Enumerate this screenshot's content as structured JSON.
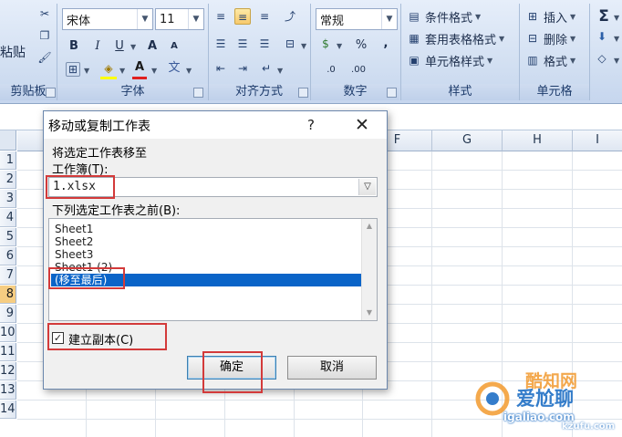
{
  "ribbon": {
    "clipboard": {
      "paste_label": "粘贴",
      "group_label": "剪贴板"
    },
    "font": {
      "font_name": "宋体",
      "font_size": "11",
      "bold": "B",
      "italic": "I",
      "underline": "U",
      "grow": "A",
      "shrink": "A",
      "font_color_glyph": "A",
      "phonetic": "文",
      "group_label": "字体"
    },
    "alignment": {
      "group_label": "对齐方式"
    },
    "number": {
      "format": "常规",
      "percent": "%",
      "comma": ",",
      "inc_decimal": ".0",
      "dec_decimal": ".00",
      "group_label": "数字"
    },
    "styles": {
      "conditional": "条件格式",
      "table_format": "套用表格格式",
      "cell_styles": "单元格样式",
      "group_label": "样式"
    },
    "cells": {
      "insert": "插入",
      "delete": "删除",
      "format": "格式",
      "group_label": "单元格"
    },
    "editing": {
      "sum": "Σ"
    }
  },
  "sheet": {
    "columns": [
      "F",
      "G",
      "H",
      "I"
    ],
    "rows": [
      "1",
      "2",
      "3",
      "4",
      "5",
      "6",
      "7",
      "8",
      "9",
      "10",
      "11",
      "12",
      "13",
      "14"
    ],
    "selected_row": "8"
  },
  "dialog": {
    "title": "移动或复制工作表",
    "help": "?",
    "close": "✕",
    "move_to_label": "将选定工作表移至",
    "workbook_label": "工作簿(T):",
    "workbook_value": "1.xlsx",
    "before_label": "下列选定工作表之前(B):",
    "sheets": [
      "Sheet1",
      "Sheet2",
      "Sheet3",
      "Sheet1 (2)",
      "(移至最后)"
    ],
    "selected_sheet": "(移至最后)",
    "create_copy_label": "建立副本(C)",
    "create_copy_checked": true,
    "ok": "确定",
    "cancel": "取消"
  },
  "watermark": {
    "line1": "酷知网",
    "line2": "爱尬聊",
    "line3": "igaliao.com",
    "line4": "kzufu.com"
  }
}
